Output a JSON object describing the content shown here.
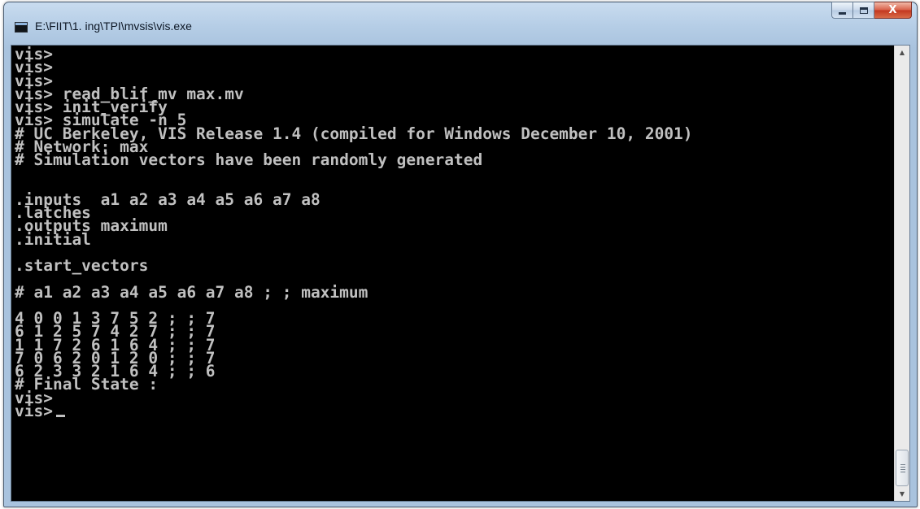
{
  "window": {
    "title": "E:\\FIIT\\1. ing\\TPI\\mvsis\\vis.exe",
    "controls": {
      "minimize_icon": "minimize-icon",
      "maximize_icon": "maximize-icon",
      "close_icon": "close-icon",
      "close_glyph": "X"
    }
  },
  "console": {
    "foreground": "#c0c0c0",
    "background": "#000000",
    "lines": [
      "vis>",
      "vis>",
      "vis>",
      "vis> read_blif_mv max.mv",
      "vis> init_verify",
      "vis> simulate -n 5",
      "# UC Berkeley, VIS Release 1.4 (compiled for Windows December 10, 2001)",
      "# Network: max",
      "# Simulation vectors have been randomly generated",
      "",
      "",
      ".inputs  a1 a2 a3 a4 a5 a6 a7 a8",
      ".latches",
      ".outputs maximum",
      ".initial",
      "",
      ".start_vectors",
      "",
      "# a1 a2 a3 a4 a5 a6 a7 a8 ; ; maximum",
      "",
      "4 0 0 1 3 7 5 2 ; ; 7",
      "6 1 2 5 7 4 2 7 ; ; 7",
      "1 1 7 2 6 1 6 4 ; ; 7",
      "7 0 6 2 0 1 2 0 ; ; 7",
      "6 2 3 3 2 1 6 4 ; ; 6",
      "# Final State :",
      "vis>",
      "vis>"
    ]
  },
  "scrollbar": {
    "up_arrow": "▲",
    "down_arrow": "▼",
    "position_fraction": 0.97
  }
}
